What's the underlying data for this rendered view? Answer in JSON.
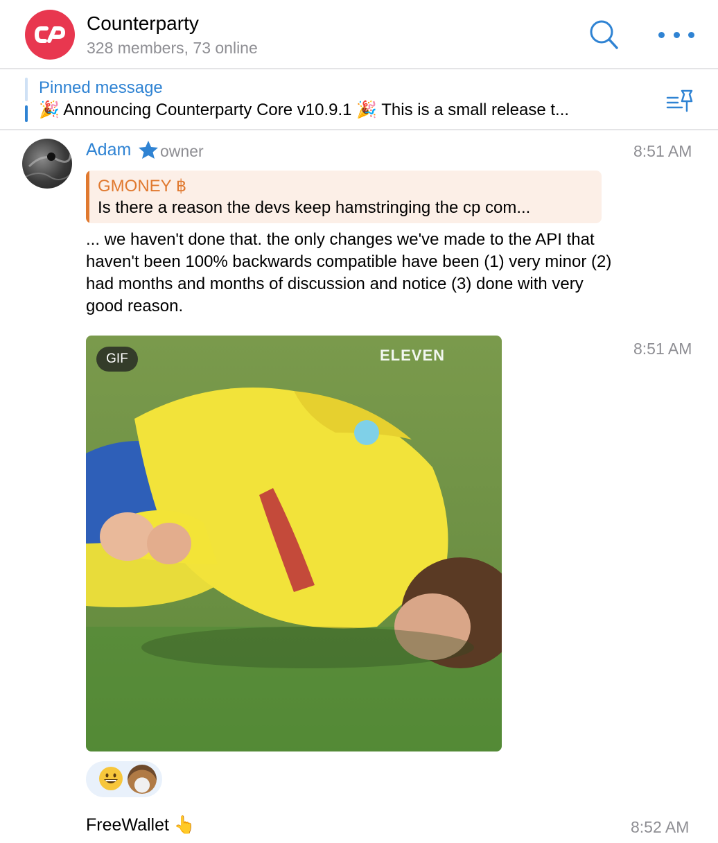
{
  "header": {
    "title": "Counterparty",
    "subtitle": "328 members, 73 online",
    "logo_letters": "cp",
    "colors": {
      "logo": "#e8374f",
      "accent": "#2f83d3"
    }
  },
  "pinned": {
    "label": "Pinned message",
    "text": "🎉 Announcing Counterparty Core v10.9.1 🎉  This is a small release t..."
  },
  "message": {
    "sender": "Adam",
    "role": "owner",
    "time": "8:51 AM",
    "reply": {
      "author": "GMONEY ฿",
      "text": "Is there a reason the devs keep hamstringing the cp com..."
    },
    "text": "... we haven't done that. the only changes we've made to the API that haven't been 100% backwards compatible have been (1) very minor (2) had months and months of discussion and notice (3) done with very good reason."
  },
  "gif_message": {
    "time": "8:51 AM",
    "badge": "GIF",
    "watermark": "ELEVEN",
    "reactions": [
      "grinning-face-emoji",
      "reactor-avatar"
    ]
  },
  "next_message": {
    "text": "FreeWallet 👆",
    "time": "8:52 AM"
  }
}
